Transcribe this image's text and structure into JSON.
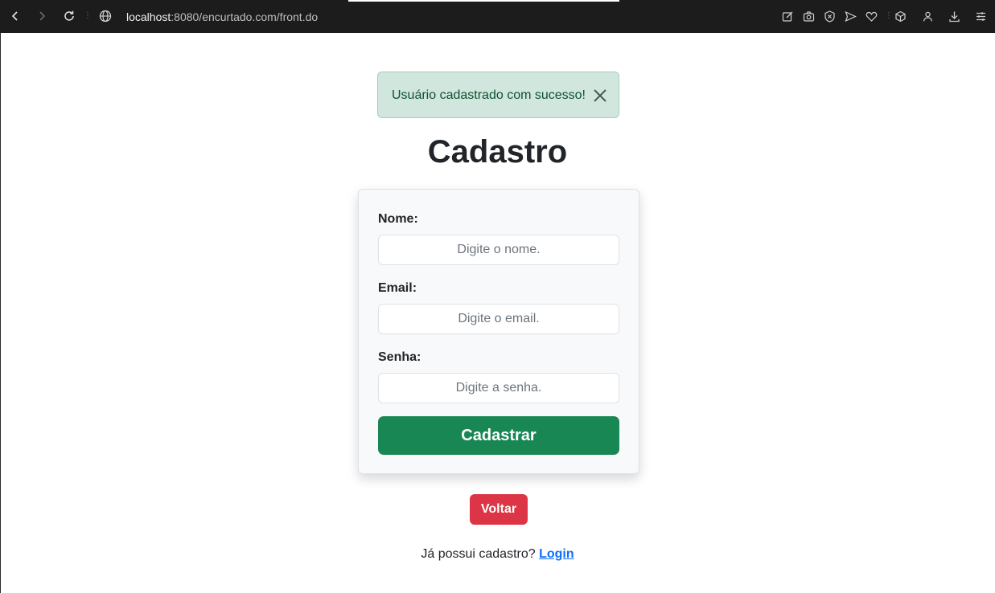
{
  "browser": {
    "url_host": "localhost",
    "url_path": ":8080/encurtado.com/front.do"
  },
  "alert": {
    "message": "Usuário cadastrado com sucesso!"
  },
  "page": {
    "title": "Cadastro"
  },
  "form": {
    "nome_label": "Nome:",
    "nome_placeholder": "Digite o nome.",
    "email_label": "Email:",
    "email_placeholder": "Digite o email.",
    "senha_label": "Senha:",
    "senha_placeholder": "Digite a senha.",
    "submit_label": "Cadastrar"
  },
  "actions": {
    "back_label": "Voltar"
  },
  "footer": {
    "prompt": "Já possui cadastro?",
    "login_link": "Login"
  },
  "colors": {
    "alert_bg": "#d1e7dd",
    "success": "#198754",
    "danger": "#dc3545",
    "link": "#0d6efd"
  }
}
